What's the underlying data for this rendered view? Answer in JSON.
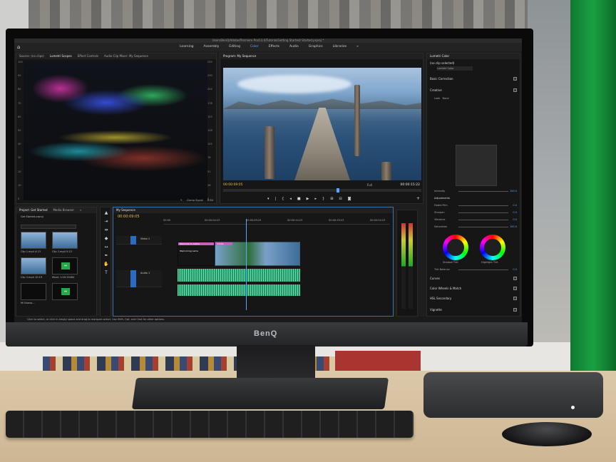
{
  "monitor": {
    "brand": "BenQ"
  },
  "app": {
    "title": "Users/BenQ/Adobe/Premiere Pro/13.0/Tutorial/Getting Started/ Started.prproj *",
    "workspaces": [
      "Learning",
      "Assembly",
      "Editing",
      "Color",
      "Effects",
      "Audio",
      "Graphics",
      "Libraries",
      "»"
    ],
    "active_workspace": "Color",
    "status_text": "Click to select, or click in empty space and drag to marquee select. Use Shift, Opt, and Cmd for other options."
  },
  "source_panel": {
    "tabs": [
      "Source: (no clips)",
      "Lumetri Scopes",
      "Effect Controls",
      "Audio Clip Mixer: My Sequence"
    ],
    "active_tab": "Lumetri Scopes",
    "scale_right": [
      "255",
      "230",
      "204",
      "178",
      "153",
      "128",
      "102",
      "76",
      "51",
      "26",
      "0"
    ],
    "scale_left": [
      "100",
      "90",
      "80",
      "70",
      "60",
      "50",
      "40",
      "30",
      "20",
      "10",
      "0"
    ],
    "clamp_label": "Clamp Signal",
    "bit_depth": "8 Bit"
  },
  "program_panel": {
    "tab": "Program: My Sequence",
    "timecode_left": "00:00:09:05",
    "timecode_right": "00:00:15:22",
    "fit": "Full",
    "position_fraction": 0.58
  },
  "lumetri": {
    "tab": "Lumetri Color",
    "clip_selected": "(no clip selected)",
    "clip_dropdown": "Lumetri Color",
    "sections": [
      "Basic Correction",
      "Creative",
      "Curves",
      "Color Wheels & Match",
      "HSL Secondary",
      "Vignette"
    ],
    "look_label": "Look",
    "look_value": "None",
    "intensity": {
      "label": "Intensity",
      "value": "100.0"
    },
    "adjustments_label": "Adjustments",
    "adjust_rows": [
      {
        "label": "Faded Film",
        "value": "0.0"
      },
      {
        "label": "Sharpen",
        "value": "0.0"
      },
      {
        "label": "Vibrance",
        "value": "0.0"
      },
      {
        "label": "Saturation",
        "value": "100.0"
      }
    ],
    "wheels": [
      "Shadow Tint",
      "Highlight Tint"
    ],
    "tint_balance": {
      "label": "Tint Balance",
      "value": "0.0"
    }
  },
  "project_panel": {
    "tabs": [
      "Project: Get Started",
      "Media Browser",
      "»"
    ],
    "project_file": "Get Started.prproj",
    "items": [
      {
        "name": "Clip 1.mp4",
        "duration": "4:13"
      },
      {
        "name": "Clip 2.mp4",
        "duration": "5:13"
      },
      {
        "name": "Clip 3.mp4",
        "duration": "10:19"
      },
      {
        "name": "Music",
        "duration": "1:00:19464"
      },
      {
        "name": "Mi Nuevo...",
        "duration": ""
      }
    ]
  },
  "timeline": {
    "tab": "My Sequence",
    "timecode": "00:00:09:05",
    "ruler": [
      "00:00",
      "00:00:04:23",
      "00:00:09:23",
      "00:00:14:23",
      "00:00:19:23",
      "00:00:24:23"
    ],
    "tracks": [
      "Video 1",
      "Audio 1"
    ],
    "clips": [
      "Welcome to Adobe",
      "Adobe",
      "Welcoming name"
    ]
  },
  "colors": {
    "accent": "#5aa6ff",
    "timecode": "#e8c24a",
    "audio_clip": "#1f9a6b",
    "video_clip": "#7aa0c8",
    "title_clip": "#c85fc0"
  }
}
